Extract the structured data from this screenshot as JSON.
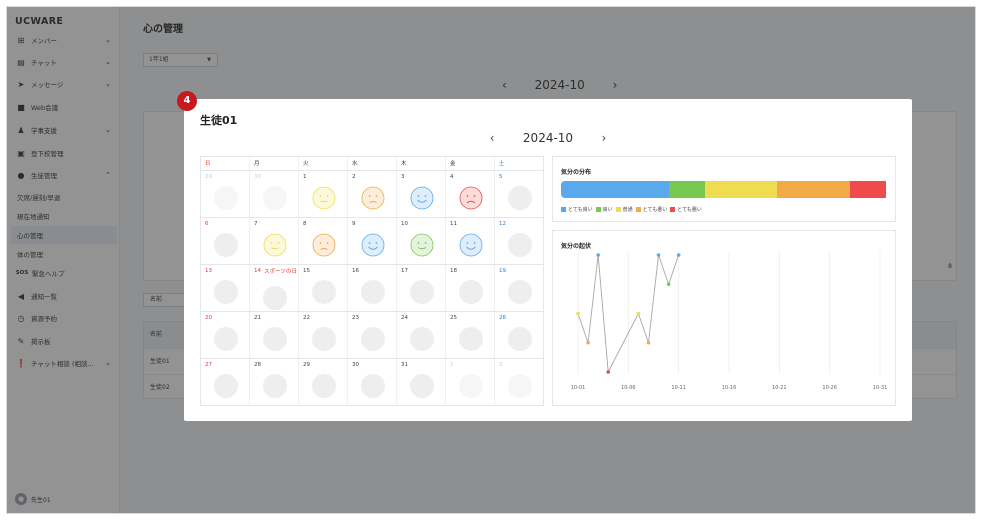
{
  "sidebar": {
    "brand": "UCWARE",
    "items": [
      {
        "label": "メンバー",
        "icon": "org-chart-icon",
        "chevron": "v"
      },
      {
        "label": "チャット",
        "icon": "chat-icon",
        "chevron": "v"
      },
      {
        "label": "メッセージ",
        "icon": "send-icon",
        "chevron": "v"
      },
      {
        "label": "Web会議",
        "icon": "video-icon",
        "chevron": ""
      },
      {
        "label": "学事支援",
        "icon": "people-icon",
        "chevron": "v"
      },
      {
        "label": "登下校管理",
        "icon": "calendar-icon",
        "chevron": ""
      },
      {
        "label": "生徒管理",
        "icon": "info-icon",
        "chevron": "^"
      }
    ],
    "sub_items": [
      "欠席/遅刻/早退",
      "現在地通知",
      "心の管理",
      "体の管理"
    ],
    "items2": [
      {
        "label": "緊急ヘルプ",
        "icon": "sos-icon",
        "chevron": ""
      },
      {
        "label": "通知一覧",
        "icon": "megaphone-icon",
        "chevron": ""
      },
      {
        "label": "資源予約",
        "icon": "clock-icon",
        "chevron": ""
      },
      {
        "label": "掲示板",
        "icon": "edit-icon",
        "chevron": ""
      },
      {
        "label": "チャット相談 (相談...",
        "icon": "alert-chat-icon",
        "chevron": "v"
      }
    ],
    "sos_prefix": "SOS",
    "user": "先生01"
  },
  "main": {
    "title": "心の管理",
    "select_value": "1年1組",
    "month": "2024-10",
    "prev": "‹",
    "next": "›",
    "chart_end_value": "8",
    "search_placeholder": "名前",
    "table_header": "名前",
    "rows": [
      "生徒01",
      "生徒02"
    ]
  },
  "modal": {
    "badge": "4",
    "title": "生徒01",
    "month": "2024-10",
    "prev": "‹",
    "next": "›",
    "weekdays": [
      "日",
      "月",
      "火",
      "水",
      "木",
      "金",
      "土"
    ],
    "weeks": [
      [
        {
          "d": "29",
          "t": "muted"
        },
        {
          "d": "30",
          "t": "muted"
        },
        {
          "d": "1",
          "m": "normal"
        },
        {
          "d": "2",
          "m": "bad"
        },
        {
          "d": "3",
          "m": "very_good"
        },
        {
          "d": "4",
          "m": "very_bad"
        },
        {
          "d": "5",
          "t": "blue"
        }
      ],
      [
        {
          "d": "6",
          "t": "red"
        },
        {
          "d": "7",
          "m": "normal"
        },
        {
          "d": "8",
          "m": "bad"
        },
        {
          "d": "9",
          "m": "very_good"
        },
        {
          "d": "10",
          "m": "good"
        },
        {
          "d": "11",
          "m": "very_good"
        },
        {
          "d": "12",
          "t": "blue"
        }
      ],
      [
        {
          "d": "13",
          "t": "red"
        },
        {
          "d": "14",
          "t": "red",
          "ev": "スポーツの日"
        },
        {
          "d": "15"
        },
        {
          "d": "16"
        },
        {
          "d": "17"
        },
        {
          "d": "18"
        },
        {
          "d": "19",
          "t": "blue"
        }
      ],
      [
        {
          "d": "20",
          "t": "red"
        },
        {
          "d": "21"
        },
        {
          "d": "22"
        },
        {
          "d": "23"
        },
        {
          "d": "24"
        },
        {
          "d": "25"
        },
        {
          "d": "26",
          "t": "blue"
        }
      ],
      [
        {
          "d": "27",
          "t": "red"
        },
        {
          "d": "28"
        },
        {
          "d": "29"
        },
        {
          "d": "30"
        },
        {
          "d": "31"
        },
        {
          "d": "1",
          "t": "muted"
        },
        {
          "d": "2",
          "t": "muted"
        }
      ]
    ],
    "distribution": {
      "title": "気分の分布",
      "segments": [
        {
          "label": "とても良い",
          "share": 0.33,
          "color": "#5aa9ee"
        },
        {
          "label": "良い",
          "share": 0.11,
          "color": "#78c850"
        },
        {
          "label": "普通",
          "share": 0.22,
          "color": "#f0dc50"
        },
        {
          "label": "とても悪い",
          "share": 0.22,
          "color": "#f0aa46"
        },
        {
          "label": "とても悪い",
          "share": 0.11,
          "color": "#f04b4b"
        }
      ]
    },
    "trend": {
      "title": "気分の起伏"
    }
  },
  "colors": {
    "very_good": "#5aa9ee",
    "good": "#78c850",
    "normal": "#f0dc50",
    "bad": "#f0aa46",
    "very_bad": "#f04b4b"
  },
  "chart_data": {
    "type": "line",
    "title": "気分の起伏",
    "x": [
      "10-01",
      "10-02",
      "10-03",
      "10-04",
      "10-07",
      "10-08",
      "10-09",
      "10-10",
      "10-11"
    ],
    "y": [
      3,
      2,
      5,
      1,
      3,
      2,
      5,
      4,
      5
    ],
    "point_moods": [
      "normal",
      "bad",
      "very_good",
      "very_bad",
      "normal",
      "bad",
      "very_good",
      "good",
      "very_good"
    ],
    "x_ticks": [
      "10-01",
      "10-06",
      "10-11",
      "10-16",
      "10-21",
      "10-26",
      "10-31"
    ],
    "xlim": [
      "10-01",
      "10-31"
    ],
    "ylim": [
      1,
      5
    ],
    "grid": "vertical"
  }
}
